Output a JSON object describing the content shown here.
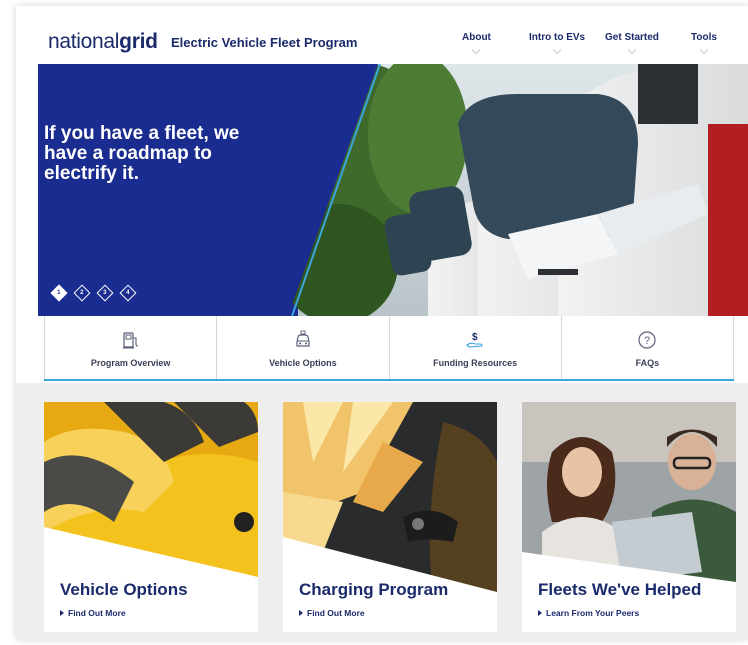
{
  "header": {
    "logo_light": "national",
    "logo_bold": "grid",
    "program_title": "Electric Vehicle Fleet Program",
    "nav": [
      "About",
      "Intro to EVs",
      "Get Started",
      "Tools"
    ]
  },
  "hero": {
    "headline": "If you have a fleet, we have a roadmap to electrify it.",
    "slides": [
      "1",
      "2",
      "3",
      "4"
    ],
    "active_slide": "1"
  },
  "tabs": [
    {
      "label": "Program Overview",
      "icon": "charging-station-icon"
    },
    {
      "label": "Vehicle Options",
      "icon": "car-icon"
    },
    {
      "label": "Funding Resources",
      "icon": "dollar-hand-icon"
    },
    {
      "label": "FAQs",
      "icon": "question-circle-icon"
    }
  ],
  "cards": [
    {
      "title": "Vehicle Options",
      "link": "Find Out More"
    },
    {
      "title": "Charging Program",
      "link": "Find Out More"
    },
    {
      "title": "Fleets We've Helped",
      "link": "Learn From Your Peers"
    }
  ],
  "colors": {
    "brand_navy": "#1b2a6b",
    "hero_blue": "#1a2c8f",
    "accent_blue": "#3aa6dd",
    "card_bg": "#eeeeef"
  }
}
